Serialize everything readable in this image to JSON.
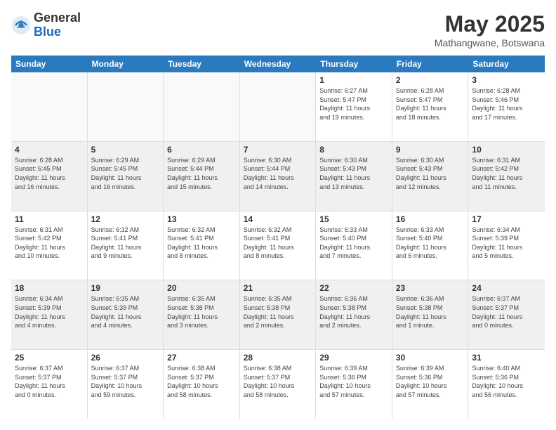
{
  "logo": {
    "general": "General",
    "blue": "Blue"
  },
  "header": {
    "month": "May 2025",
    "location": "Mathangwane, Botswana"
  },
  "weekdays": [
    "Sunday",
    "Monday",
    "Tuesday",
    "Wednesday",
    "Thursday",
    "Friday",
    "Saturday"
  ],
  "weeks": [
    [
      {
        "day": "",
        "info": "",
        "empty": true
      },
      {
        "day": "",
        "info": "",
        "empty": true
      },
      {
        "day": "",
        "info": "",
        "empty": true
      },
      {
        "day": "",
        "info": "",
        "empty": true
      },
      {
        "day": "1",
        "info": "Sunrise: 6:27 AM\nSunset: 5:47 PM\nDaylight: 11 hours\nand 19 minutes.",
        "empty": false
      },
      {
        "day": "2",
        "info": "Sunrise: 6:28 AM\nSunset: 5:47 PM\nDaylight: 11 hours\nand 18 minutes.",
        "empty": false
      },
      {
        "day": "3",
        "info": "Sunrise: 6:28 AM\nSunset: 5:46 PM\nDaylight: 11 hours\nand 17 minutes.",
        "empty": false
      }
    ],
    [
      {
        "day": "4",
        "info": "Sunrise: 6:28 AM\nSunset: 5:45 PM\nDaylight: 11 hours\nand 16 minutes.",
        "empty": false
      },
      {
        "day": "5",
        "info": "Sunrise: 6:29 AM\nSunset: 5:45 PM\nDaylight: 11 hours\nand 16 minutes.",
        "empty": false
      },
      {
        "day": "6",
        "info": "Sunrise: 6:29 AM\nSunset: 5:44 PM\nDaylight: 11 hours\nand 15 minutes.",
        "empty": false
      },
      {
        "day": "7",
        "info": "Sunrise: 6:30 AM\nSunset: 5:44 PM\nDaylight: 11 hours\nand 14 minutes.",
        "empty": false
      },
      {
        "day": "8",
        "info": "Sunrise: 6:30 AM\nSunset: 5:43 PM\nDaylight: 11 hours\nand 13 minutes.",
        "empty": false
      },
      {
        "day": "9",
        "info": "Sunrise: 6:30 AM\nSunset: 5:43 PM\nDaylight: 11 hours\nand 12 minutes.",
        "empty": false
      },
      {
        "day": "10",
        "info": "Sunrise: 6:31 AM\nSunset: 5:42 PM\nDaylight: 11 hours\nand 11 minutes.",
        "empty": false
      }
    ],
    [
      {
        "day": "11",
        "info": "Sunrise: 6:31 AM\nSunset: 5:42 PM\nDaylight: 11 hours\nand 10 minutes.",
        "empty": false
      },
      {
        "day": "12",
        "info": "Sunrise: 6:32 AM\nSunset: 5:41 PM\nDaylight: 11 hours\nand 9 minutes.",
        "empty": false
      },
      {
        "day": "13",
        "info": "Sunrise: 6:32 AM\nSunset: 5:41 PM\nDaylight: 11 hours\nand 8 minutes.",
        "empty": false
      },
      {
        "day": "14",
        "info": "Sunrise: 6:32 AM\nSunset: 5:41 PM\nDaylight: 11 hours\nand 8 minutes.",
        "empty": false
      },
      {
        "day": "15",
        "info": "Sunrise: 6:33 AM\nSunset: 5:40 PM\nDaylight: 11 hours\nand 7 minutes.",
        "empty": false
      },
      {
        "day": "16",
        "info": "Sunrise: 6:33 AM\nSunset: 5:40 PM\nDaylight: 11 hours\nand 6 minutes.",
        "empty": false
      },
      {
        "day": "17",
        "info": "Sunrise: 6:34 AM\nSunset: 5:39 PM\nDaylight: 11 hours\nand 5 minutes.",
        "empty": false
      }
    ],
    [
      {
        "day": "18",
        "info": "Sunrise: 6:34 AM\nSunset: 5:39 PM\nDaylight: 11 hours\nand 4 minutes.",
        "empty": false
      },
      {
        "day": "19",
        "info": "Sunrise: 6:35 AM\nSunset: 5:39 PM\nDaylight: 11 hours\nand 4 minutes.",
        "empty": false
      },
      {
        "day": "20",
        "info": "Sunrise: 6:35 AM\nSunset: 5:38 PM\nDaylight: 11 hours\nand 3 minutes.",
        "empty": false
      },
      {
        "day": "21",
        "info": "Sunrise: 6:35 AM\nSunset: 5:38 PM\nDaylight: 11 hours\nand 2 minutes.",
        "empty": false
      },
      {
        "day": "22",
        "info": "Sunrise: 6:36 AM\nSunset: 5:38 PM\nDaylight: 11 hours\nand 2 minutes.",
        "empty": false
      },
      {
        "day": "23",
        "info": "Sunrise: 6:36 AM\nSunset: 5:38 PM\nDaylight: 11 hours\nand 1 minute.",
        "empty": false
      },
      {
        "day": "24",
        "info": "Sunrise: 6:37 AM\nSunset: 5:37 PM\nDaylight: 11 hours\nand 0 minutes.",
        "empty": false
      }
    ],
    [
      {
        "day": "25",
        "info": "Sunrise: 6:37 AM\nSunset: 5:37 PM\nDaylight: 11 hours\nand 0 minutes.",
        "empty": false
      },
      {
        "day": "26",
        "info": "Sunrise: 6:37 AM\nSunset: 5:37 PM\nDaylight: 10 hours\nand 59 minutes.",
        "empty": false
      },
      {
        "day": "27",
        "info": "Sunrise: 6:38 AM\nSunset: 5:37 PM\nDaylight: 10 hours\nand 58 minutes.",
        "empty": false
      },
      {
        "day": "28",
        "info": "Sunrise: 6:38 AM\nSunset: 5:37 PM\nDaylight: 10 hours\nand 58 minutes.",
        "empty": false
      },
      {
        "day": "29",
        "info": "Sunrise: 6:39 AM\nSunset: 5:36 PM\nDaylight: 10 hours\nand 57 minutes.",
        "empty": false
      },
      {
        "day": "30",
        "info": "Sunrise: 6:39 AM\nSunset: 5:36 PM\nDaylight: 10 hours\nand 57 minutes.",
        "empty": false
      },
      {
        "day": "31",
        "info": "Sunrise: 6:40 AM\nSunset: 5:36 PM\nDaylight: 10 hours\nand 56 minutes.",
        "empty": false
      }
    ]
  ]
}
